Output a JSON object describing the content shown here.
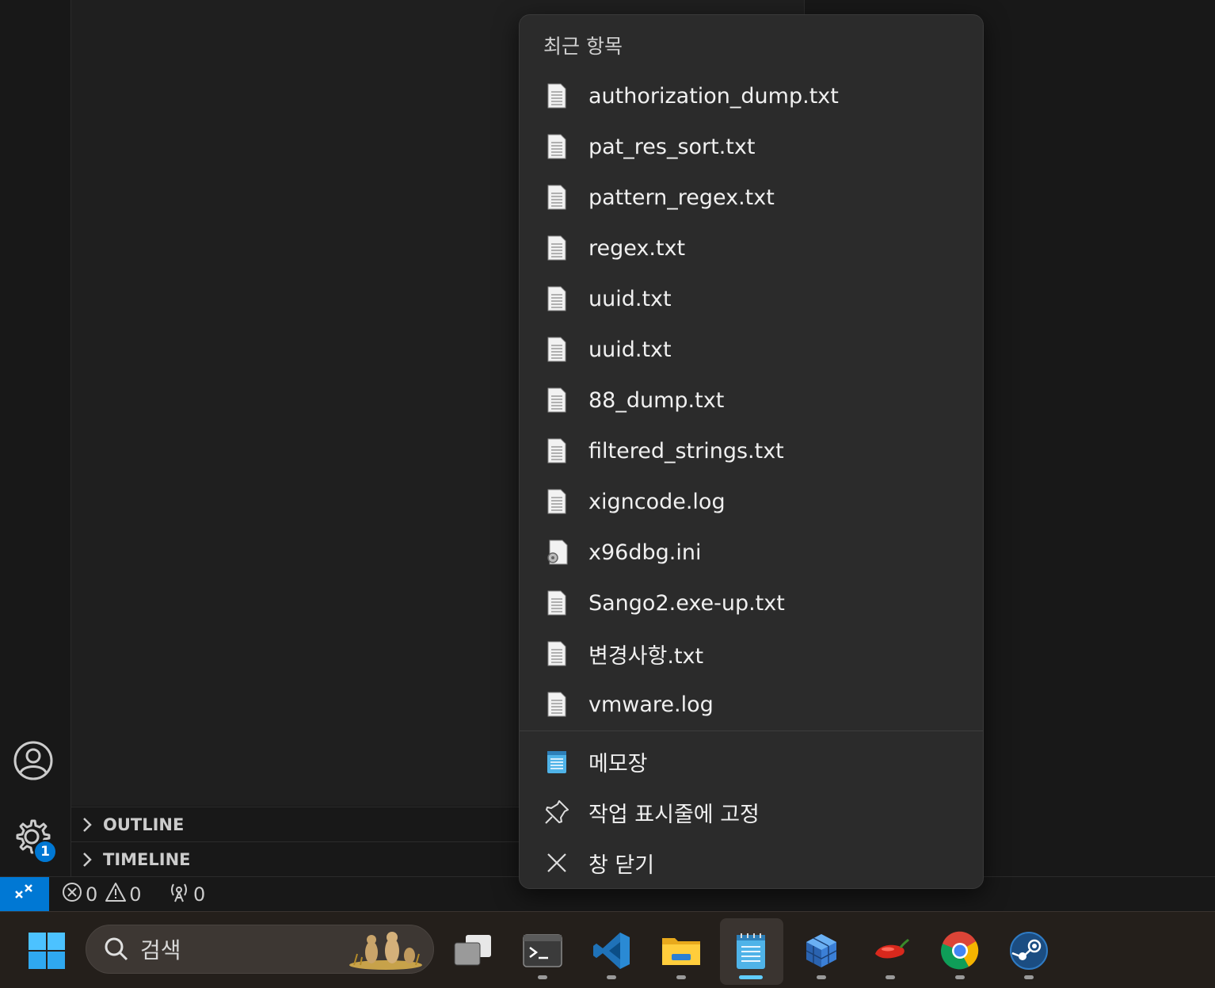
{
  "jumplist": {
    "header": "최근 항목",
    "recent_items": [
      {
        "label": "authorization_dump.txt",
        "icon": "text-file-icon"
      },
      {
        "label": "pat_res_sort.txt",
        "icon": "text-file-icon"
      },
      {
        "label": "pattern_regex.txt",
        "icon": "text-file-icon"
      },
      {
        "label": "regex.txt",
        "icon": "text-file-icon"
      },
      {
        "label": "uuid.txt",
        "icon": "text-file-icon"
      },
      {
        "label": "uuid.txt",
        "icon": "text-file-icon"
      },
      {
        "label": "88_dump.txt",
        "icon": "text-file-icon"
      },
      {
        "label": "filtered_strings.txt",
        "icon": "text-file-icon"
      },
      {
        "label": "xigncode.log",
        "icon": "text-file-icon"
      },
      {
        "label": "x96dbg.ini",
        "icon": "settings-file-icon"
      },
      {
        "label": "Sango2.exe-up.txt",
        "icon": "text-file-icon"
      },
      {
        "label": "변경사항.txt",
        "icon": "text-file-icon"
      },
      {
        "label": "vmware.log",
        "icon": "text-file-icon"
      }
    ],
    "tasks": {
      "notepad": "메모장",
      "pin": "작업 표시줄에 고정",
      "close": "창 닫기"
    }
  },
  "panels": {
    "outline": "OUTLINE",
    "timeline": "TIMELINE"
  },
  "activity": {
    "settings_badge": "1"
  },
  "statusbar": {
    "errors": "0",
    "warnings": "0",
    "ports": "0"
  },
  "taskbar": {
    "search_placeholder": "검색",
    "apps": [
      "start-icon",
      "task-view-icon",
      "terminal-icon",
      "vscode-icon",
      "file-explorer-icon",
      "notepad-icon",
      "cube-app-icon",
      "pepper-app-icon",
      "chrome-icon",
      "steam-icon"
    ]
  },
  "colors": {
    "accent": "#0078d4",
    "menu_bg": "#2b2b2b",
    "taskbar_bg": "#241f1b",
    "active_indicator": "#60cdff"
  }
}
